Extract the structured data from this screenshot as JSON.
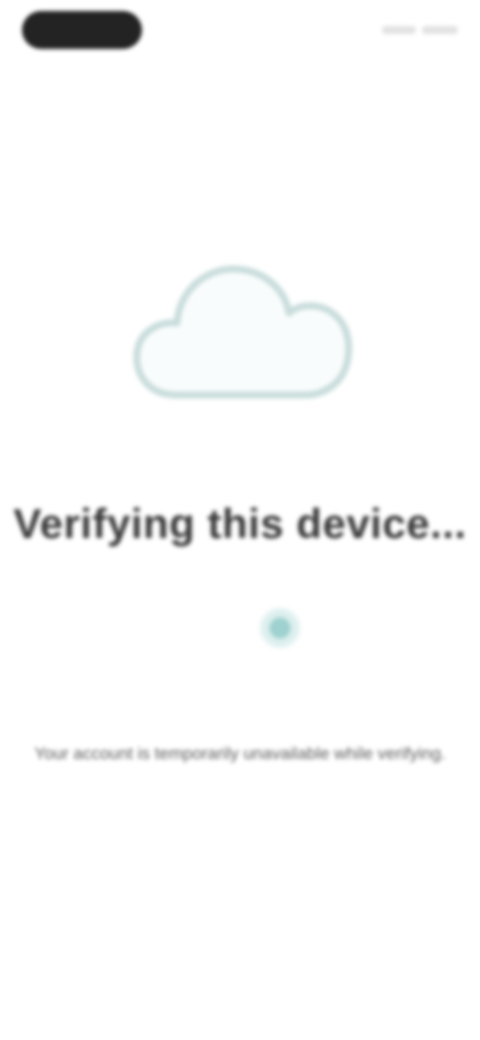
{
  "status_bar": {
    "pill": "",
    "right_indicators": ""
  },
  "icons": {
    "cloud": "cloud-icon",
    "spinner": "loading-spinner"
  },
  "colors": {
    "cloud_stroke": "#c9dddc",
    "spinner_accent": "#9ed1cf",
    "title_text": "#3a3a3a",
    "body_text": "#5c5c5c"
  },
  "main": {
    "title": "Verifying this device...",
    "subtitle": "Your account is temporarily unavailable while verifying."
  }
}
